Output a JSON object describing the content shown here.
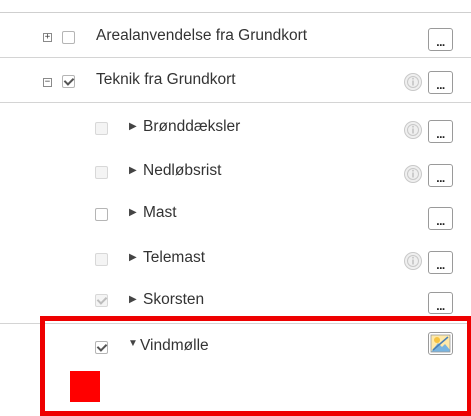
{
  "layers": [
    {
      "label": "Arealanvendelse fra Grundkort",
      "expander": "+",
      "checked": false,
      "disabled": false,
      "info_icon": false,
      "menu_label": "..."
    },
    {
      "label": "Teknik fra Grundkort",
      "expander": "−",
      "checked": true,
      "disabled": false,
      "info_icon": true,
      "menu_label": "..."
    },
    {
      "label": "Brønddæksler",
      "caret": "▶",
      "checked": false,
      "disabled": true,
      "info_icon": true,
      "menu_label": "..."
    },
    {
      "label": "Nedløbsrist",
      "caret": "▶",
      "checked": false,
      "disabled": true,
      "info_icon": true,
      "menu_label": "..."
    },
    {
      "label": "Mast",
      "caret": "▶",
      "checked": false,
      "disabled": false,
      "info_icon": false,
      "menu_label": "..."
    },
    {
      "label": "Telemast",
      "caret": "▶",
      "checked": false,
      "disabled": true,
      "info_icon": true,
      "menu_label": "..."
    },
    {
      "label": "Skorsten",
      "caret": "▶",
      "checked": true,
      "disabled": true,
      "info_icon": false,
      "menu_label": "..."
    },
    {
      "label": "Vindmølle",
      "caret": "▼",
      "checked": true,
      "disabled": false,
      "info_icon": false,
      "style_icon": "layer-style-icon"
    }
  ],
  "colors": {
    "highlight": "#ee0000",
    "legend_swatch": "#ff0000"
  }
}
